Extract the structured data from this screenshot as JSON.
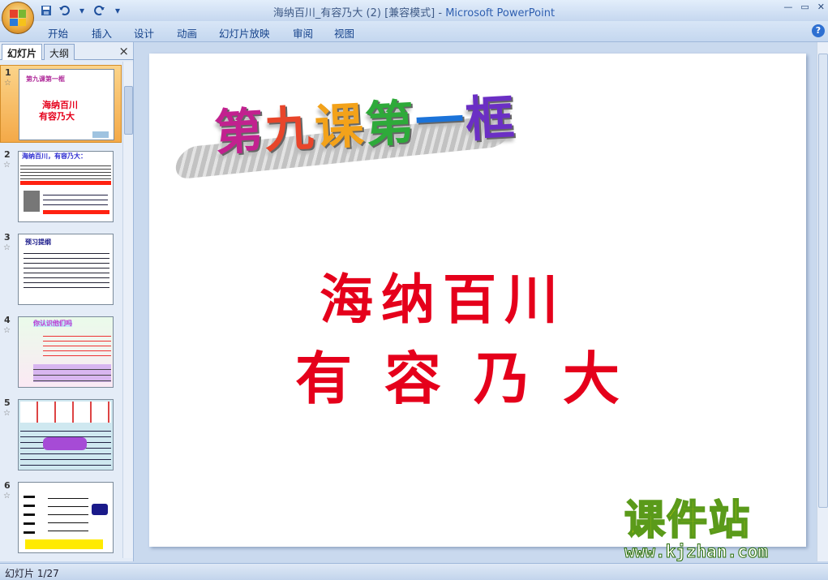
{
  "window": {
    "title": "海纳百川_有容乃大 (2) [兼容模式]",
    "app_name": "Microsoft PowerPoint",
    "separator": " - "
  },
  "ribbon": {
    "tabs": [
      "开始",
      "插入",
      "设计",
      "动画",
      "幻灯片放映",
      "审阅",
      "视图"
    ]
  },
  "panel": {
    "tab_slides": "幻灯片",
    "tab_outline": "大纲",
    "close_glyph": "×"
  },
  "thumbnails": [
    {
      "num": "1",
      "title": "第九课第一框",
      "line1": "海纳百川",
      "line2": "有容乃大"
    },
    {
      "num": "2",
      "title": "海纳百川，有容乃大："
    },
    {
      "num": "3",
      "title": "预习提纲"
    },
    {
      "num": "4",
      "title": "你认识他们吗"
    },
    {
      "num": "5"
    },
    {
      "num": "6"
    }
  ],
  "slide": {
    "title": "第九课第一框",
    "line1": "海纳百川",
    "line2": "有容乃大"
  },
  "watermark": {
    "title": "课件站",
    "url": "www.kjzhan.com"
  },
  "status": {
    "slide_indicator": "幻灯片 1/27"
  },
  "colors": {
    "accent": "#e5001b",
    "selected_thumb": "#f4a948"
  }
}
